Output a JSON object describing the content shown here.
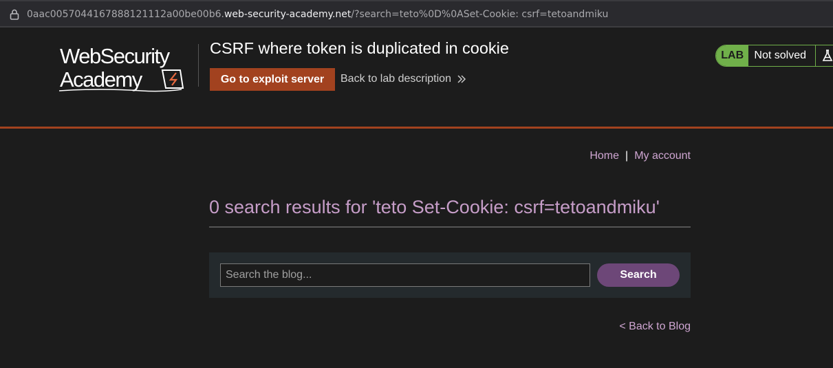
{
  "browser": {
    "url_prefix": "0aac0057044167888121112a00be00b6.",
    "url_host": "web-security-academy.net",
    "url_path": "/?search=teto%0D%0ASet-Cookie: csrf=tetoandmiku"
  },
  "header": {
    "logo_line1": "WebSecurity",
    "logo_line2": "Academy",
    "lab_title": "CSRF where token is duplicated in cookie",
    "exploit_button": "Go to exploit server",
    "back_to_description": "Back to lab description",
    "status_badge": "LAB",
    "status_text": "Not solved",
    "accent_color": "#a2421f",
    "status_color": "#70b04a"
  },
  "nav": {
    "home": "Home",
    "separator": "|",
    "account": "My account"
  },
  "main": {
    "results_heading": "0 search results for 'teto Set-Cookie: csrf=tetoandmiku'",
    "search_placeholder": "Search the blog...",
    "search_button": "Search",
    "back_to_blog": "< Back to Blog"
  }
}
